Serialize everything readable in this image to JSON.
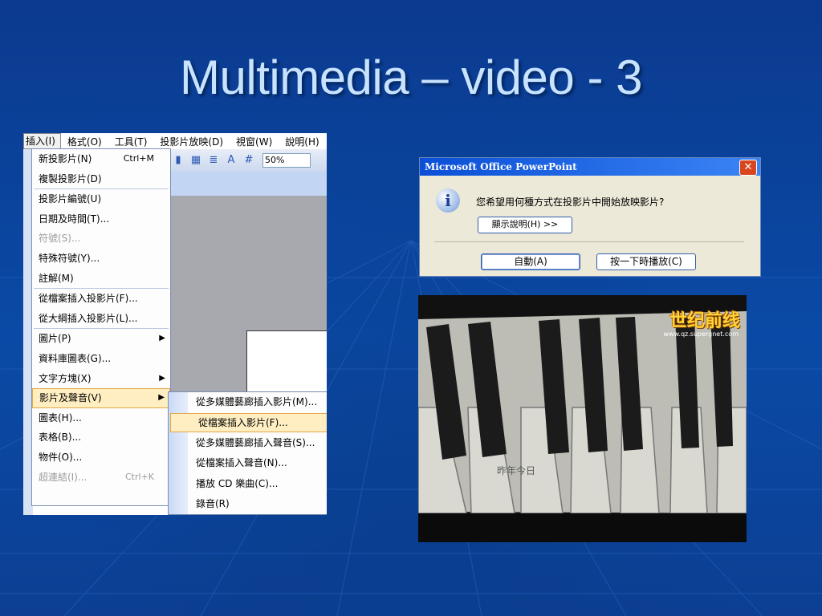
{
  "slide": {
    "title": "Multimedia – video - 3"
  },
  "menubar": {
    "items": [
      "插入(I)",
      "格式(O)",
      "工具(T)",
      "投影片放映(D)",
      "視窗(W)",
      "說明(H)"
    ]
  },
  "toolbar": {
    "zoom": "50%"
  },
  "insert_menu": {
    "new_slide": "新投影片(N)",
    "new_slide_shortcut": "Ctrl+M",
    "duplicate_slide": "複製投影片(D)",
    "slide_number": "投影片編號(U)",
    "date_time": "日期及時間(T)...",
    "symbol": "符號(S)...",
    "special_symbol": "特殊符號(Y)...",
    "comment": "註解(M)",
    "slides_from_file": "從檔案插入投影片(F)...",
    "slides_from_outline": "從大綱插入投影片(L)...",
    "picture": "圖片(P)",
    "database_chart": "資料庫圖表(G)...",
    "text_box": "文字方塊(X)",
    "movies_sounds": "影片及聲音(V)",
    "chart": "圖表(H)...",
    "table": "表格(B)...",
    "object": "物件(O)...",
    "hyperlink": "超連結(I)...",
    "hyperlink_shortcut": "Ctrl+K"
  },
  "movies_submenu": {
    "movie_from_gallery": "從多媒體藝廊插入影片(M)...",
    "movie_from_file": "從檔案插入影片(F)...",
    "sound_from_gallery": "從多媒體藝廊插入聲音(S)...",
    "sound_from_file": "從檔案插入聲音(N)...",
    "play_cd": "播放 CD 樂曲(C)...",
    "record": "錄音(R)"
  },
  "dialog": {
    "title": "Microsoft Office PowerPoint",
    "message": "您希望用何種方式在投影片中開始放映影片?",
    "help_button": "顯示說明(H) >>",
    "auto_button": "自動(A)",
    "on_click_button": "按一下時播放(C)"
  },
  "video": {
    "logo": "世纪前线",
    "url": "www.qz.supergnet.com",
    "caption": "昨年今日"
  },
  "colors": {
    "background": "#0a4aa6",
    "title": "#c8e3ff",
    "menu_highlight": "#ffeec2",
    "dialog_title_bar": "#0a4fd6",
    "dialog_face": "#ece9d8"
  }
}
